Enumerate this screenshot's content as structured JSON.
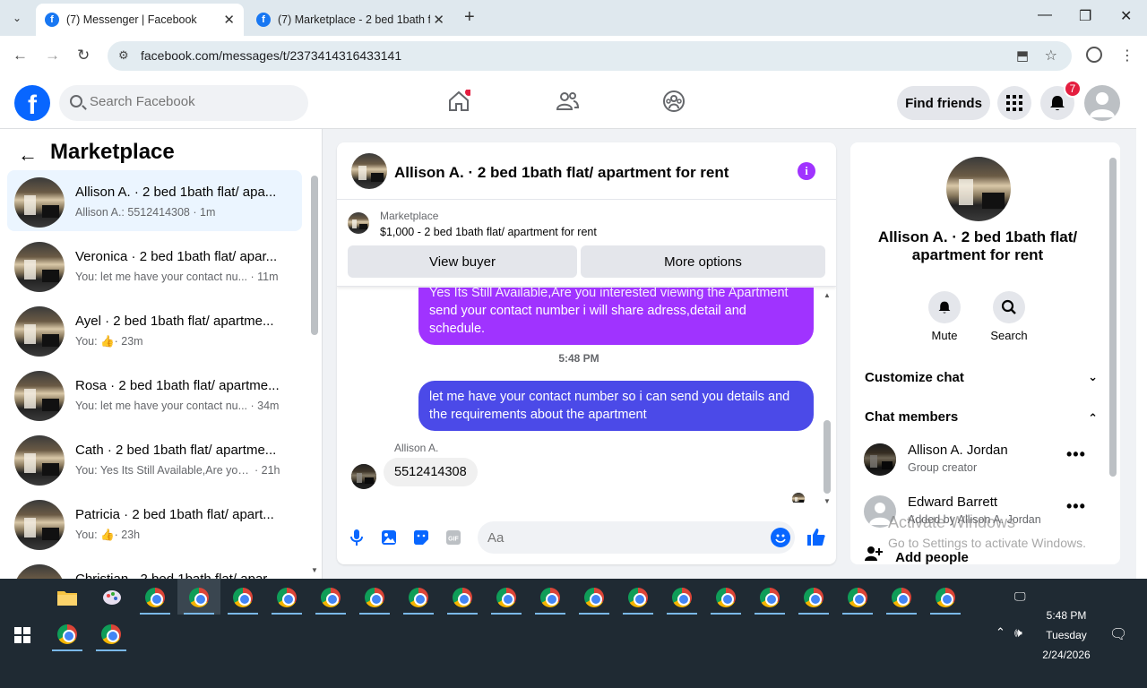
{
  "browser": {
    "tabs": [
      {
        "title": "(7) Messenger | Facebook",
        "active": true
      },
      {
        "title": "(7) Marketplace - 2 bed 1bath f",
        "active": false
      }
    ],
    "url": "facebook.com/messages/t/2373414316433141"
  },
  "header": {
    "search_placeholder": "Search Facebook",
    "find_friends": "Find friends",
    "notif_count": "7",
    "colors": {
      "brand": "#0866ff",
      "badge": "#e41e3f"
    }
  },
  "left": {
    "title": "Marketplace",
    "conversations": [
      {
        "name": "Allison A. · 2 bed 1bath flat/ apa...",
        "snippet": "Allison A.: 5512414308",
        "time": "· 1m",
        "active": true
      },
      {
        "name": "Veronica · 2 bed 1bath flat/ apar...",
        "snippet": "You: let me have your contact nu...",
        "time": "· 11m",
        "active": false
      },
      {
        "name": "Ayel · 2 bed 1bath flat/ apartme...",
        "snippet": "You:",
        "time": "· 23m",
        "like": true,
        "active": false
      },
      {
        "name": "Rosa · 2 bed 1bath flat/ apartme...",
        "snippet": "You: let me have your contact nu...",
        "time": "· 34m",
        "active": false
      },
      {
        "name": "Cath · 2 bed 1bath flat/ apartme...",
        "snippet": "You: Yes Its Still Available,Are you i...",
        "time": "· 21h",
        "active": false
      },
      {
        "name": "Patricia · 2 bed 1bath flat/ apart...",
        "snippet": "You:",
        "time": "· 23h",
        "like": true,
        "active": false
      },
      {
        "name": "Christian · 2 bed 1bath flat/ apar...",
        "snippet": "",
        "time": "",
        "active": false
      }
    ]
  },
  "chat": {
    "title": "Allison A. · 2 bed 1bath flat/ apartment for rent",
    "listing_label": "Marketplace",
    "listing_desc": "$1,000 - 2 bed 1bath flat/ apartment for rent",
    "view_buyer": "View buyer",
    "more_options": "More options",
    "messages": {
      "out1_partial": "Yes Its Still Available,Are you interested viewing the Apartment",
      "out1": "send your contact number i will share adress,detail and schedule.",
      "time_sep": "5:48 PM",
      "out2": "let me have your contact number so i can send you details and the requirements about the apartment",
      "sender": "Allison A.",
      "in1": "5512414308"
    },
    "composer_placeholder": "Aa",
    "colors": {
      "bubble_top": "#a033ff",
      "bubble_bottom": "#4b4ae8"
    }
  },
  "right": {
    "title": "Allison A. · 2 bed 1bath flat/ apartment for rent",
    "mute": "Mute",
    "search": "Search",
    "customize_chat": "Customize chat",
    "chat_members": "Chat members",
    "members": [
      {
        "name": "Allison A. Jordan",
        "sub": "Group creator"
      },
      {
        "name": "Edward Barrett",
        "sub": "Added by Allison A. Jordan"
      }
    ],
    "add_people": "Add people",
    "watermark_1": "Activate Windows",
    "watermark_2": "Go to Settings to activate Windows."
  },
  "taskbar": {
    "time": "5:48 PM",
    "day": "Tuesday",
    "date": "2/24/2026"
  }
}
